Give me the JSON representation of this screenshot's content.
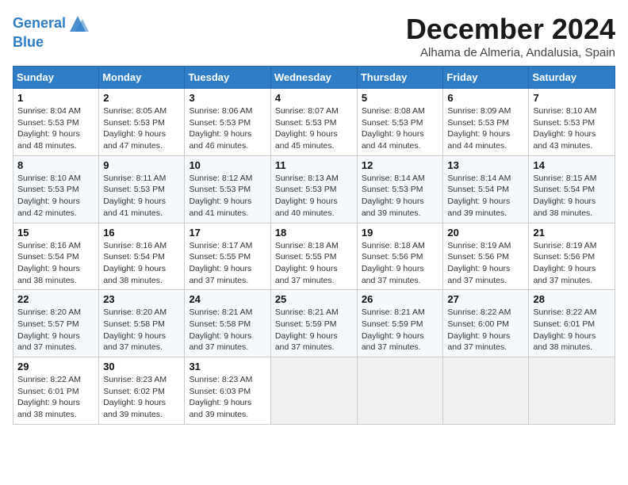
{
  "header": {
    "logo_line1": "General",
    "logo_line2": "Blue",
    "month_title": "December 2024",
    "location": "Alhama de Almeria, Andalusia, Spain"
  },
  "weekdays": [
    "Sunday",
    "Monday",
    "Tuesday",
    "Wednesday",
    "Thursday",
    "Friday",
    "Saturday"
  ],
  "weeks": [
    [
      {
        "day": "1",
        "sunrise": "8:04 AM",
        "sunset": "5:53 PM",
        "daylight": "9 hours and 48 minutes."
      },
      {
        "day": "2",
        "sunrise": "8:05 AM",
        "sunset": "5:53 PM",
        "daylight": "9 hours and 47 minutes."
      },
      {
        "day": "3",
        "sunrise": "8:06 AM",
        "sunset": "5:53 PM",
        "daylight": "9 hours and 46 minutes."
      },
      {
        "day": "4",
        "sunrise": "8:07 AM",
        "sunset": "5:53 PM",
        "daylight": "9 hours and 45 minutes."
      },
      {
        "day": "5",
        "sunrise": "8:08 AM",
        "sunset": "5:53 PM",
        "daylight": "9 hours and 44 minutes."
      },
      {
        "day": "6",
        "sunrise": "8:09 AM",
        "sunset": "5:53 PM",
        "daylight": "9 hours and 44 minutes."
      },
      {
        "day": "7",
        "sunrise": "8:10 AM",
        "sunset": "5:53 PM",
        "daylight": "9 hours and 43 minutes."
      }
    ],
    [
      {
        "day": "8",
        "sunrise": "8:10 AM",
        "sunset": "5:53 PM",
        "daylight": "9 hours and 42 minutes."
      },
      {
        "day": "9",
        "sunrise": "8:11 AM",
        "sunset": "5:53 PM",
        "daylight": "9 hours and 41 minutes."
      },
      {
        "day": "10",
        "sunrise": "8:12 AM",
        "sunset": "5:53 PM",
        "daylight": "9 hours and 41 minutes."
      },
      {
        "day": "11",
        "sunrise": "8:13 AM",
        "sunset": "5:53 PM",
        "daylight": "9 hours and 40 minutes."
      },
      {
        "day": "12",
        "sunrise": "8:14 AM",
        "sunset": "5:53 PM",
        "daylight": "9 hours and 39 minutes."
      },
      {
        "day": "13",
        "sunrise": "8:14 AM",
        "sunset": "5:54 PM",
        "daylight": "9 hours and 39 minutes."
      },
      {
        "day": "14",
        "sunrise": "8:15 AM",
        "sunset": "5:54 PM",
        "daylight": "9 hours and 38 minutes."
      }
    ],
    [
      {
        "day": "15",
        "sunrise": "8:16 AM",
        "sunset": "5:54 PM",
        "daylight": "9 hours and 38 minutes."
      },
      {
        "day": "16",
        "sunrise": "8:16 AM",
        "sunset": "5:54 PM",
        "daylight": "9 hours and 38 minutes."
      },
      {
        "day": "17",
        "sunrise": "8:17 AM",
        "sunset": "5:55 PM",
        "daylight": "9 hours and 37 minutes."
      },
      {
        "day": "18",
        "sunrise": "8:18 AM",
        "sunset": "5:55 PM",
        "daylight": "9 hours and 37 minutes."
      },
      {
        "day": "19",
        "sunrise": "8:18 AM",
        "sunset": "5:56 PM",
        "daylight": "9 hours and 37 minutes."
      },
      {
        "day": "20",
        "sunrise": "8:19 AM",
        "sunset": "5:56 PM",
        "daylight": "9 hours and 37 minutes."
      },
      {
        "day": "21",
        "sunrise": "8:19 AM",
        "sunset": "5:56 PM",
        "daylight": "9 hours and 37 minutes."
      }
    ],
    [
      {
        "day": "22",
        "sunrise": "8:20 AM",
        "sunset": "5:57 PM",
        "daylight": "9 hours and 37 minutes."
      },
      {
        "day": "23",
        "sunrise": "8:20 AM",
        "sunset": "5:58 PM",
        "daylight": "9 hours and 37 minutes."
      },
      {
        "day": "24",
        "sunrise": "8:21 AM",
        "sunset": "5:58 PM",
        "daylight": "9 hours and 37 minutes."
      },
      {
        "day": "25",
        "sunrise": "8:21 AM",
        "sunset": "5:59 PM",
        "daylight": "9 hours and 37 minutes."
      },
      {
        "day": "26",
        "sunrise": "8:21 AM",
        "sunset": "5:59 PM",
        "daylight": "9 hours and 37 minutes."
      },
      {
        "day": "27",
        "sunrise": "8:22 AM",
        "sunset": "6:00 PM",
        "daylight": "9 hours and 37 minutes."
      },
      {
        "day": "28",
        "sunrise": "8:22 AM",
        "sunset": "6:01 PM",
        "daylight": "9 hours and 38 minutes."
      }
    ],
    [
      {
        "day": "29",
        "sunrise": "8:22 AM",
        "sunset": "6:01 PM",
        "daylight": "9 hours and 38 minutes."
      },
      {
        "day": "30",
        "sunrise": "8:23 AM",
        "sunset": "6:02 PM",
        "daylight": "9 hours and 39 minutes."
      },
      {
        "day": "31",
        "sunrise": "8:23 AM",
        "sunset": "6:03 PM",
        "daylight": "9 hours and 39 minutes."
      },
      null,
      null,
      null,
      null
    ]
  ],
  "labels": {
    "sunrise": "Sunrise:",
    "sunset": "Sunset:",
    "daylight": "Daylight:"
  }
}
